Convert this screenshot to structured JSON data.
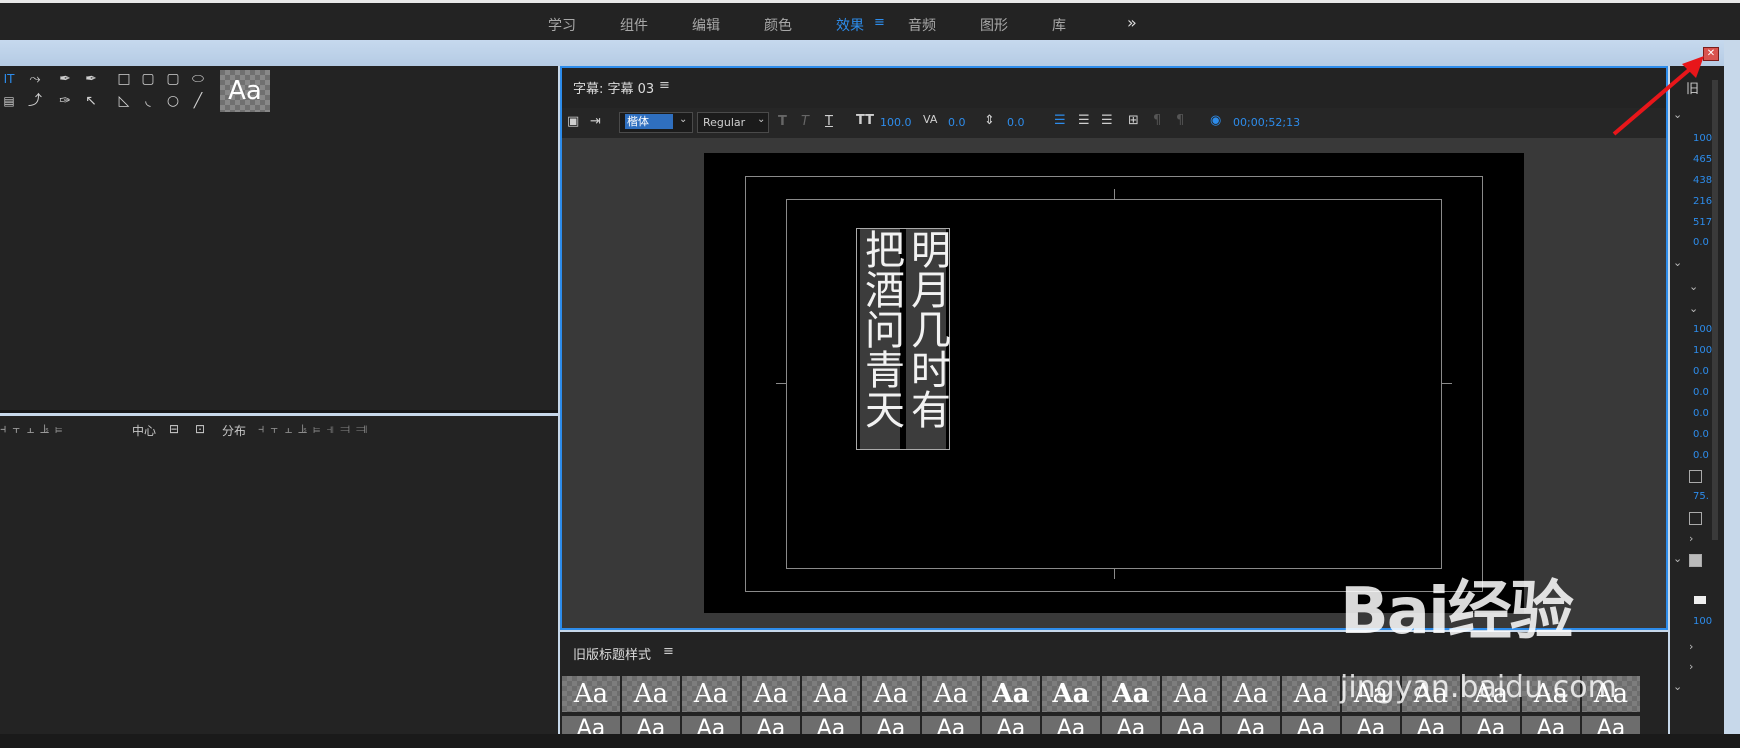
{
  "workspace_tabs": [
    "学习",
    "组件",
    "编辑",
    "颜色",
    "效果",
    "音频",
    "图形",
    "库"
  ],
  "active_tab": "效果",
  "more_icon": "»",
  "title_panel": {
    "header": "字幕: 字幕 03",
    "menu_icon": "≡",
    "font": "楷体",
    "style": "Regular",
    "font_size": "100.0",
    "kerning": "0.0",
    "leading": "0.0",
    "timecode": "00;00;52;13"
  },
  "title_text": {
    "col1": "明月几时有",
    "col2": "把酒问青天"
  },
  "align_panel": {
    "center_label": "中心",
    "distribute_label": "分布"
  },
  "styles_panel": {
    "header": "旧版标题样式",
    "swatch_label": "Aa",
    "swatch_count": 18
  },
  "right_panel": {
    "header": "旧",
    "values": [
      "100",
      "465",
      "438",
      "216",
      "517",
      "0.0",
      "100",
      "100",
      "0.0",
      "0.0",
      "0.0",
      "0.0",
      "0.0",
      "75.",
      "100"
    ]
  },
  "preview_label": "Aa",
  "watermark": {
    "logo": "Bai经验",
    "url": "jingyan.baidu.com"
  },
  "colors": {
    "accent": "#2d8ceb",
    "panel": "#232323",
    "canvas": "#000000"
  }
}
